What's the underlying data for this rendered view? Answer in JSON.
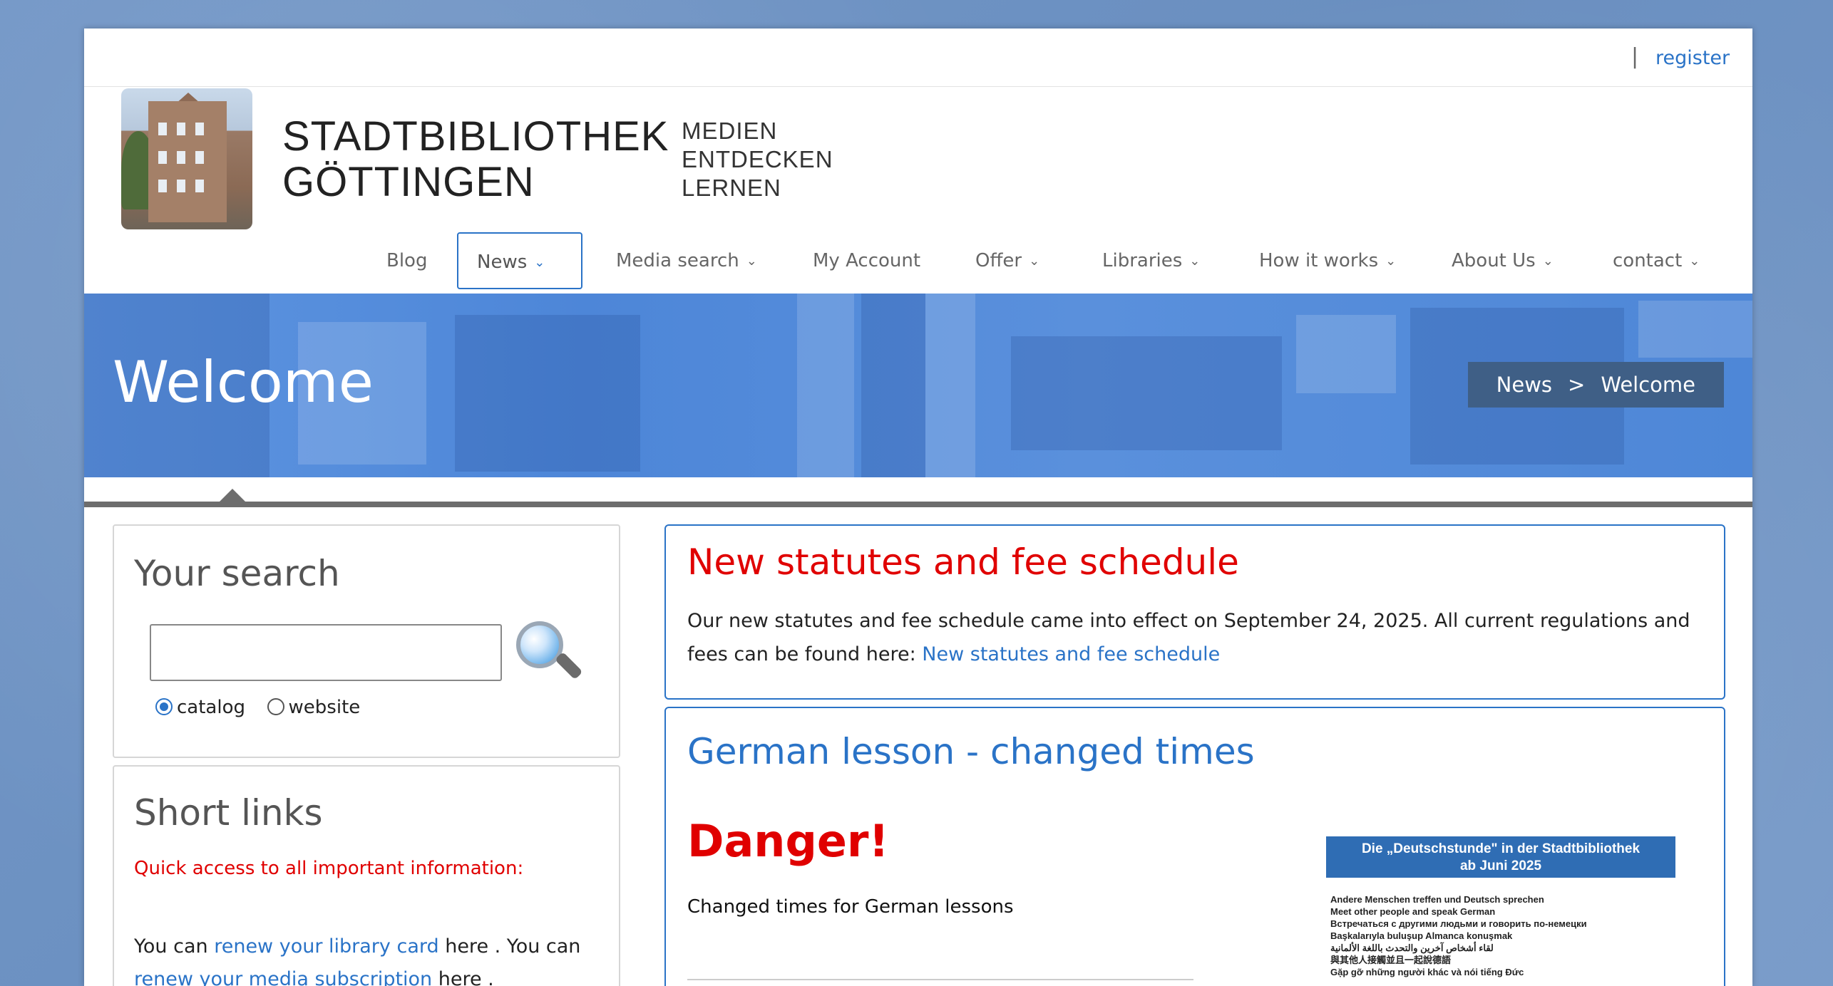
{
  "topbar": {
    "separator": "|",
    "register_label": "register"
  },
  "brand": {
    "line1": "STADTBIBLIOTHEK",
    "line2": "GÖTTINGEN"
  },
  "tagline": {
    "line1": "MEDIEN",
    "line2": "ENTDECKEN",
    "line3": "LERNEN"
  },
  "nav": {
    "items": [
      {
        "label": "Blog",
        "has_menu": false
      },
      {
        "label": "News",
        "has_menu": true,
        "active": true
      },
      {
        "label": "Media search",
        "has_menu": true
      },
      {
        "label": "My Account",
        "has_menu": false
      },
      {
        "label": "Offer",
        "has_menu": true
      },
      {
        "label": "Libraries",
        "has_menu": true
      },
      {
        "label": "How it works",
        "has_menu": true
      },
      {
        "label": "About Us",
        "has_menu": true
      },
      {
        "label": "contact",
        "has_menu": true
      }
    ]
  },
  "banner": {
    "title": "Welcome",
    "breadcrumb": {
      "parent": "News",
      "separator": ">",
      "current": "Welcome"
    }
  },
  "search": {
    "title": "Your search",
    "input_value": "",
    "options": [
      {
        "label": "catalog",
        "checked": true
      },
      {
        "label": "website",
        "checked": false
      }
    ]
  },
  "shortlinks": {
    "title": "Short links",
    "quick_access": "Quick access to all important information:",
    "text_1": "You can ",
    "link_1": "renew your library card",
    "text_2": " here . You can ",
    "link_2": "renew your media subscription",
    "text_3": " here ."
  },
  "news": [
    {
      "title": "New statutes and fee schedule",
      "body": "Our new statutes and fee schedule came into effect on September 24, 2025. All current regulations and fees can be found here: ",
      "link": "New statutes and fee schedule"
    },
    {
      "title": "German lesson - changed times",
      "alert": "Danger!",
      "subtitle": "Changed times for German lessons",
      "flyer": {
        "heading_line1": "Die „Deutschstunde\" in der Stadtbibliothek",
        "heading_line2": "ab Juni 2025",
        "lines": [
          "Andere Menschen treffen und Deutsch sprechen",
          "Meet other people and speak German",
          "Встречаться с другими людьми и говорить по-немецки",
          "Başkalarıyla buluşup Almanca konuşmak",
          "لقاء أشخاص آخرين والتحدث باللغة الألمانية",
          "與其他人接觸並且一起說德語",
          "Gặp gỡ những người khác và nói tiếng Đức"
        ]
      }
    }
  ],
  "colors": {
    "link": "#2a73c7",
    "alert": "#e00000",
    "banner": "#4d86d8",
    "breadcrumb_bg": "#3f5f86"
  },
  "icons": {
    "search": "magnifier-icon",
    "chevron": "chevron-down-icon"
  }
}
